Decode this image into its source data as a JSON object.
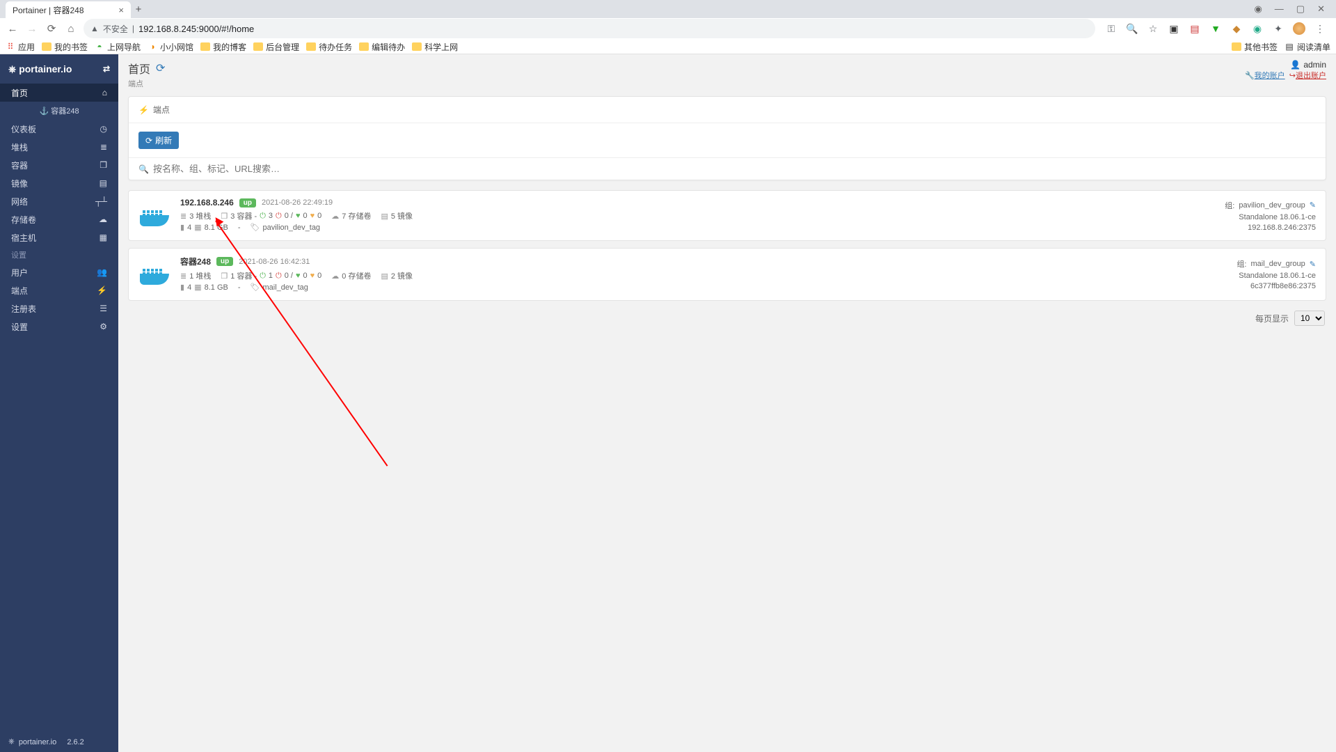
{
  "browser": {
    "tab_title": "Portainer | 容器248",
    "url_insecure": "不安全",
    "url": "192.168.8.245:9000/#!/home",
    "bookmarks": [
      "应用",
      "我的书签",
      "上网导航",
      "小小网馆",
      "我的博客",
      "后台管理",
      "待办任务",
      "编辑待办",
      "科学上网"
    ],
    "bm_right": [
      "其他书签",
      "阅读清单"
    ]
  },
  "sidebar": {
    "brand": "portainer.io",
    "items": [
      {
        "label": "首页",
        "icon": "⌂"
      },
      {
        "label": "容器248",
        "sub": true,
        "icon": "⚓"
      },
      {
        "label": "仪表板",
        "icon": "◷"
      },
      {
        "label": "堆栈",
        "icon": "≣"
      },
      {
        "label": "容器",
        "icon": "❒"
      },
      {
        "label": "镜像",
        "icon": "▤"
      },
      {
        "label": "网络",
        "icon": "┬┴"
      },
      {
        "label": "存储卷",
        "icon": "☁"
      },
      {
        "label": "宿主机",
        "icon": "▦"
      }
    ],
    "settings_label": "设置",
    "settings": [
      {
        "label": "用户",
        "icon": "👥"
      },
      {
        "label": "端点",
        "icon": "⚡"
      },
      {
        "label": "注册表",
        "icon": "☰"
      },
      {
        "label": "设置",
        "icon": "⚙"
      }
    ],
    "footer_brand": "portainer.io",
    "footer_ver": "2.6.2"
  },
  "header": {
    "title": "首页",
    "subtitle": "端点",
    "user_label": "admin",
    "my_account": "我的账户",
    "logout": "退出账户"
  },
  "panel": {
    "title": "端点",
    "refresh": "刷新",
    "search_placeholder": "按名称、组、标记、URL搜索…"
  },
  "endpoints": [
    {
      "name": "192.168.8.246",
      "status": "up",
      "time": "2021-08-26 22:49:19",
      "stacks": "3 堆栈",
      "containers": "3 容器",
      "power": "3",
      "stopped": "0",
      "h1": "0",
      "h2": "0",
      "volumes": "7 存储卷",
      "images": "5 镜像",
      "cpu": "4",
      "ram": "8.1 GB",
      "tag": "pavilion_dev_tag",
      "group_label": "组:",
      "group": "pavilion_dev_group",
      "edition": "Standalone 18.06.1-ce",
      "addr": "192.168.8.246:2375"
    },
    {
      "name": "容器248",
      "status": "up",
      "time": "2021-08-26 16:42:31",
      "stacks": "1 堆栈",
      "containers": "1 容器",
      "power": "1",
      "stopped": "0",
      "h1": "0",
      "h2": "0",
      "volumes": "0 存储卷",
      "images": "2 镜像",
      "cpu": "4",
      "ram": "8.1 GB",
      "tag": "mail_dev_tag",
      "group_label": "组:",
      "group": "mail_dev_group",
      "edition": "Standalone 18.06.1-ce",
      "addr": "6c377ffb8e86:2375"
    }
  ],
  "pager": {
    "label": "每页显示",
    "value": "10"
  }
}
